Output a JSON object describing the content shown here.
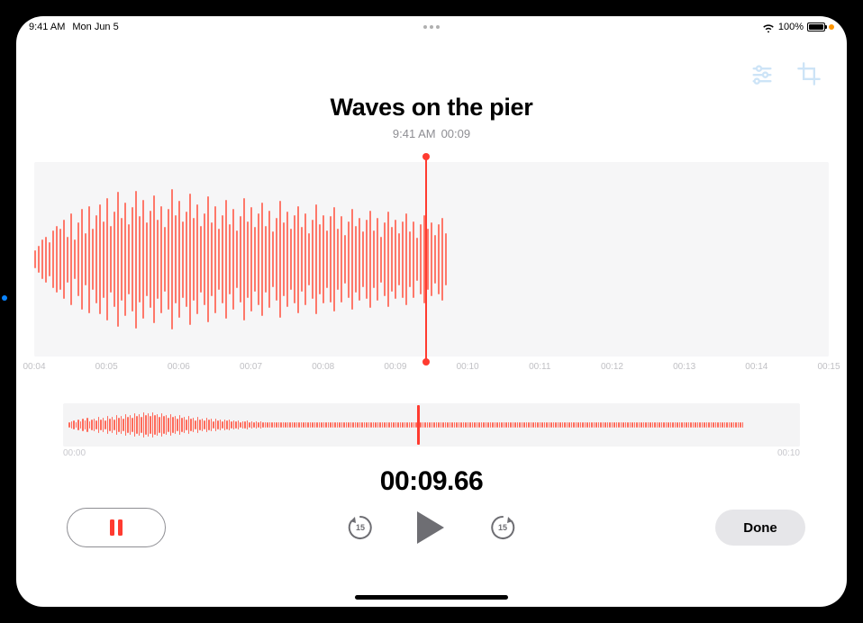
{
  "statusbar": {
    "time": "9:41 AM",
    "date": "Mon Jun 5",
    "battery_pct": "100%"
  },
  "title": "Waves on the pier",
  "meta": {
    "time": "9:41 AM",
    "duration": "00:09"
  },
  "main_wave": {
    "ticks": [
      "00:04",
      "00:05",
      "00:06",
      "00:07",
      "00:08",
      "00:09",
      "00:10",
      "00:11",
      "00:12",
      "00:13",
      "00:14",
      "00:15"
    ],
    "playhead_pct": 49.2,
    "bars": [
      12,
      18,
      26,
      30,
      22,
      38,
      44,
      40,
      52,
      30,
      60,
      26,
      48,
      66,
      34,
      70,
      40,
      58,
      72,
      50,
      80,
      44,
      62,
      88,
      54,
      74,
      46,
      68,
      90,
      56,
      78,
      48,
      64,
      84,
      52,
      70,
      42,
      66,
      92,
      58,
      76,
      50,
      62,
      86,
      54,
      72,
      44,
      60,
      82,
      48,
      70,
      40,
      58,
      78,
      46,
      66,
      38,
      56,
      80,
      50,
      68,
      42,
      60,
      74,
      44,
      64,
      36,
      54,
      76,
      48,
      62,
      40,
      58,
      70,
      42,
      60,
      34,
      52,
      72,
      46,
      58,
      38,
      56,
      68,
      40,
      56,
      32,
      50,
      66,
      44,
      54,
      36,
      52,
      64,
      38,
      54,
      30,
      48,
      62,
      42,
      52,
      34,
      50,
      60,
      36,
      50,
      28,
      46,
      58,
      40,
      48,
      32,
      46,
      54,
      34
    ]
  },
  "overview": {
    "start": "00:00",
    "end": "00:10",
    "playhead_pct": 48.0,
    "bars": [
      6,
      8,
      10,
      6,
      12,
      8,
      14,
      10,
      16,
      8,
      12,
      14,
      10,
      18,
      12,
      16,
      10,
      20,
      14,
      18,
      12,
      22,
      16,
      20,
      14,
      24,
      18,
      22,
      16,
      26,
      20,
      24,
      18,
      28,
      22,
      26,
      20,
      28,
      22,
      24,
      18,
      26,
      20,
      22,
      16,
      24,
      18,
      20,
      14,
      22,
      16,
      18,
      12,
      20,
      14,
      16,
      10,
      18,
      12,
      14,
      10,
      16,
      12,
      14,
      8,
      14,
      10,
      12,
      8,
      12,
      10,
      12,
      8,
      10,
      8,
      10,
      6,
      8,
      8,
      10,
      6,
      8,
      6,
      8,
      6,
      8,
      6,
      6,
      6,
      6,
      6,
      6,
      6,
      6,
      6,
      6,
      6,
      6,
      6,
      6,
      6,
      6,
      6,
      6,
      6,
      6,
      6,
      6,
      6,
      6,
      6,
      6,
      6,
      6,
      6,
      6,
      6,
      6,
      6,
      6,
      6,
      6,
      6,
      6,
      6,
      6,
      6,
      6,
      6,
      6,
      6,
      6,
      6,
      6,
      6,
      6,
      6,
      6,
      6,
      6,
      6,
      6,
      6,
      6,
      6,
      6,
      6,
      6,
      6,
      6,
      6,
      6,
      6,
      6,
      6,
      6,
      6,
      6,
      6,
      6,
      6,
      6,
      6,
      6,
      6,
      6,
      6,
      6,
      6,
      6,
      6,
      6,
      6,
      6,
      6,
      6,
      6,
      6,
      6,
      6,
      6,
      6,
      6,
      6,
      6,
      6,
      6,
      6,
      6,
      6,
      6,
      6,
      6,
      6,
      6,
      6,
      6,
      6,
      6,
      6,
      6,
      6,
      6,
      6,
      6,
      6,
      6,
      6,
      6,
      6,
      6,
      6,
      6,
      6,
      6,
      6,
      6,
      6,
      6,
      6,
      6,
      6,
      6,
      6,
      6,
      6,
      6,
      6,
      6,
      6,
      6,
      6,
      6,
      6,
      6,
      6,
      6,
      6,
      6,
      6,
      6,
      6,
      6,
      6,
      6,
      6,
      6,
      6,
      6,
      6,
      6,
      6,
      6,
      6,
      6,
      6,
      6,
      6,
      6,
      6,
      6,
      6,
      6,
      6,
      6,
      6,
      6,
      6,
      6,
      6,
      6,
      6,
      6,
      6,
      6,
      6,
      6,
      6,
      6,
      6,
      6,
      6,
      6,
      6,
      6,
      6,
      6,
      6,
      6,
      6,
      6,
      6,
      6,
      6,
      6,
      6,
      6,
      6,
      6,
      6
    ]
  },
  "timecode": "00:09.66",
  "controls": {
    "skip_back": "15",
    "skip_fwd": "15",
    "done": "Done"
  }
}
